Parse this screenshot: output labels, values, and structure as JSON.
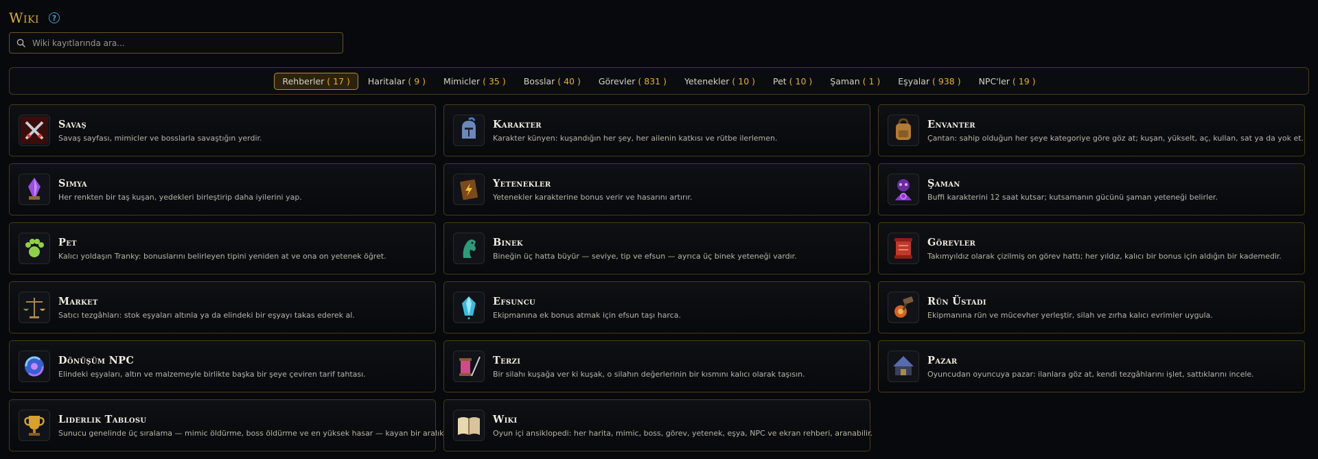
{
  "header": {
    "title": "Wiki",
    "help_symbol": "?"
  },
  "search": {
    "placeholder": "Wiki kayıtlarında ara..."
  },
  "tabs": [
    {
      "label": "Rehberler",
      "count": "( 17 )",
      "active": true
    },
    {
      "label": "Haritalar",
      "count": "( 9 )"
    },
    {
      "label": "Mimicler",
      "count": "( 35 )"
    },
    {
      "label": "Bosslar",
      "count": "( 40 )"
    },
    {
      "label": "Görevler",
      "count": "( 831 )"
    },
    {
      "label": "Yetenekler",
      "count": "( 10 )"
    },
    {
      "label": "Pet",
      "count": "( 10 )"
    },
    {
      "label": "Şaman",
      "count": "( 1 )"
    },
    {
      "label": "Eşyalar",
      "count": "( 938 )"
    },
    {
      "label": "NPC'ler",
      "count": "( 19 )"
    }
  ],
  "cards": [
    {
      "name": "Savaş",
      "desc": "Savaş sayfası, mimicler ve bosslarla savaştığın yerdir.",
      "icon": "crossed-swords-icon"
    },
    {
      "name": "Karakter",
      "desc": "Karakter künyen: kuşandığın her şey, her ailenin katkısı ve rütbe ilerlemen.",
      "icon": "knight-helmet-icon"
    },
    {
      "name": "Envanter",
      "desc": "Çantan: sahip olduğun her şeye kategoriye göre göz at; kuşan, yükselt, aç, kullan, sat ya da yok et.",
      "icon": "backpack-icon"
    },
    {
      "name": "Simya",
      "desc": "Her renkten bir taş kuşan, yedekleri birleştirip daha iyilerini yap.",
      "icon": "crystal-icon"
    },
    {
      "name": "Yetenekler",
      "desc": "Yetenekler karakterine bonus verir ve hasarını artırır.",
      "icon": "spellbook-icon"
    },
    {
      "name": "Şaman",
      "desc": "Buffi karakterini 12 saat kutsar; kutsamanın gücünü şaman yeteneği belirler.",
      "icon": "shaman-icon"
    },
    {
      "name": "Pet",
      "desc": "Kalıcı yoldaşın Tranky: bonuslarını belirleyen tipini yeniden at ve ona on yetenek öğret.",
      "icon": "paw-icon"
    },
    {
      "name": "Binek",
      "desc": "Bineğin üç hatta büyür — seviye, tip ve efsun — ayrıca üç binek yeteneği vardır.",
      "icon": "horse-head-icon"
    },
    {
      "name": "Görevler",
      "desc": "Takımyıldız olarak çizilmiş on görev hattı; her yıldız, kalıcı bir bonus için aldığın bir kademedir.",
      "icon": "scroll-icon"
    },
    {
      "name": "Market",
      "desc": "Satıcı tezgâhları: stok eşyaları altınla ya da elindeki bir eşyayı takas ederek al.",
      "icon": "scales-icon"
    },
    {
      "name": "Efsuncu",
      "desc": "Ekipmanına ek bonus atmak için efsun taşı harca.",
      "icon": "enchant-gem-icon"
    },
    {
      "name": "Rün Üstadı",
      "desc": "Ekipmanına rün ve mücevher yerleştir, silah ve zırha kalıcı evrimler uygula.",
      "icon": "rune-hammer-icon"
    },
    {
      "name": "Dönüşüm NPC",
      "desc": "Elindeki eşyaları, altın ve malzemeyle birlikte başka bir şeye çeviren tarif tahtası.",
      "icon": "transform-orb-icon"
    },
    {
      "name": "Terzi",
      "desc": "Bir silahı kuşağa ver ki kuşak, o silahın değerlerinin bir kısmını kalıcı olarak taşısın.",
      "icon": "thread-needle-icon"
    },
    {
      "name": "Pazar",
      "desc": "Oyuncudan oyuncuya pazar: ilanlara göz at, kendi tezgâhlarını işlet, sattıklarını incele.",
      "icon": "market-tent-icon"
    },
    {
      "name": "Liderlik Tablosu",
      "desc": "Sunucu genelinde üç sıralama — mimic öldürme, boss öldürme ve en yüksek hasar — kayan bir aralıkta.",
      "icon": "trophy-icon"
    },
    {
      "name": "Wiki",
      "desc": "Oyun içi ansiklopedi: her harita, mimic, boss, görev, yetenek, eşya, NPC ve ekran rehberi, aranabilir.",
      "icon": "open-book-icon"
    }
  ]
}
